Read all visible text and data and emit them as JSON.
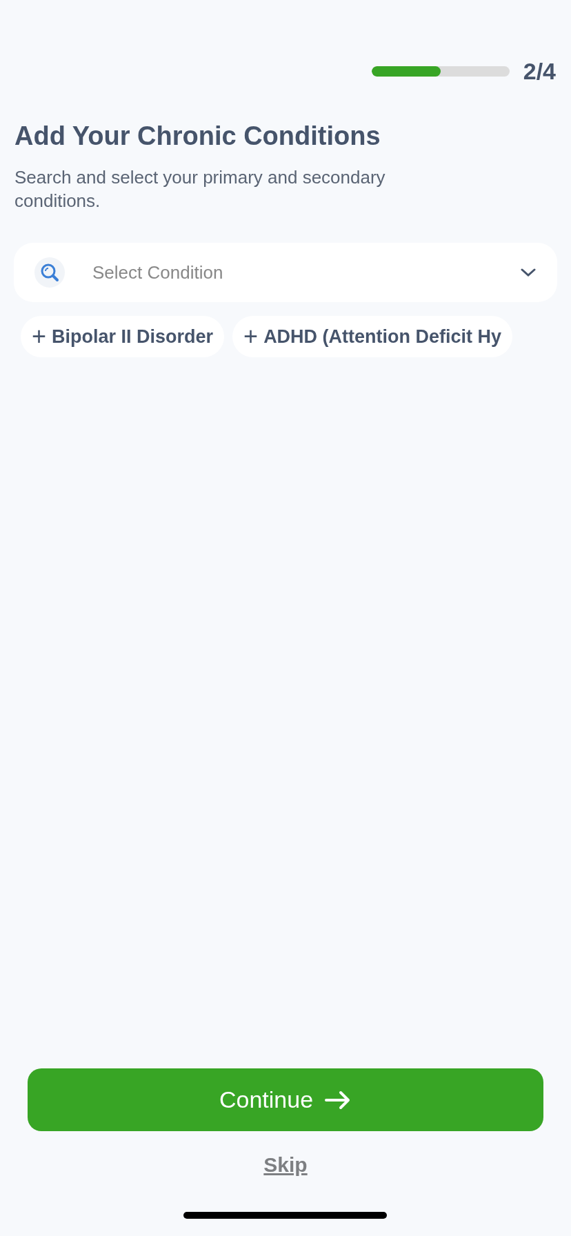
{
  "progress": {
    "level": 0.5,
    "label": "2/4"
  },
  "title": "Add Your Chronic Conditions",
  "subtitle": "Search and select your primary and secondary conditions.",
  "search": {
    "placeholder": "Select Condition"
  },
  "suggestions": [
    {
      "label": "Bipolar II Disorder",
      "icon": "+"
    },
    {
      "label": "ADHD (Attention Deficit Hy",
      "icon": "+"
    }
  ],
  "continue_button": {
    "label": "Continue"
  },
  "skip_link": "Skip"
}
